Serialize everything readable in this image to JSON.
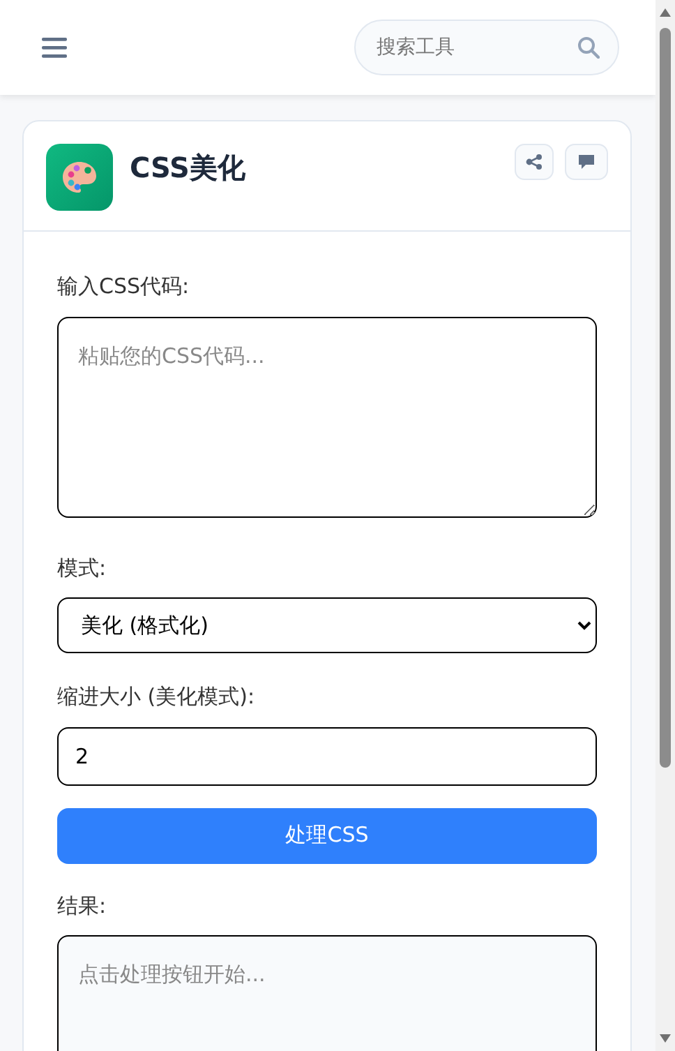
{
  "header": {
    "search": {
      "placeholder": "搜索工具"
    }
  },
  "tool": {
    "title": "CSS美化",
    "form": [
      {
        "kind": "textarea",
        "label": "输入CSS代码:",
        "placeholder": "粘贴您的CSS代码..."
      },
      {
        "kind": "select",
        "label": "模式:",
        "value": "美化 (格式化)"
      },
      {
        "kind": "input",
        "label": "缩进大小 (美化模式):",
        "value": "2"
      },
      {
        "kind": "button",
        "label": "处理CSS"
      },
      {
        "kind": "result",
        "label": "结果:",
        "placeholder": "点击处理按钮开始..."
      }
    ]
  }
}
